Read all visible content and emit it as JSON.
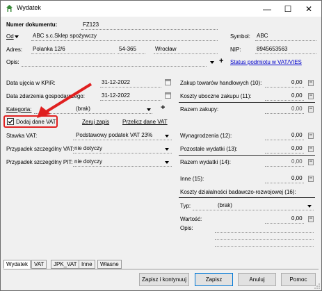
{
  "window": {
    "title": "Wydatek",
    "minimize": "—",
    "maximize": "☐",
    "close": "✕"
  },
  "header": {
    "doc_number_label": "Numer dokumentu:",
    "doc_number_value": "FZ123",
    "od_label": "Od",
    "contractor": "ABC s.c.Sklep spożywczy",
    "symbol_label": "Symbol:",
    "symbol_value": "ABC",
    "address_label": "Adres:",
    "street": "Polanka 12/6",
    "postcode": "54-365",
    "city": "Wrocław",
    "nip_label": "NIP:",
    "nip_value": "8945653563",
    "opis_label": "Opis:",
    "plus": "+",
    "vat_status_link": "Status podmiotu w VAT/VIES"
  },
  "left": {
    "kpir_date_label": "Data ujęcia w KPiR:",
    "kpir_date": "31-12-2022",
    "event_date_label": "Data zdarzenia gospodarczego:",
    "event_date": "31-12-2022",
    "category_label": "Kategoria:",
    "category_value": "(brak)",
    "plus": "+",
    "add_vat_label": "Dodaj dane VAT",
    "reset_link": "Zeruj zapis",
    "recalc_link": "Przelicz dane VAT",
    "vat_rate_label": "Stawka VAT:",
    "vat_rate_value": "Podstawowy podatek VAT 23%",
    "special_vat_label": "Przypadek szczególny VAT:",
    "special_vat_value": "nie dotyczy",
    "special_pit_label": "Przypadek szczególny PIT:",
    "special_pit_value": "nie dotyczy"
  },
  "right": {
    "purchase_label": "Zakup towarów handlowych (10):",
    "purchase_value": "0,00",
    "side_costs_label": "Koszty uboczne zakupu (11):",
    "side_costs_value": "0,00",
    "total_purchase_label": "Razem zakupy:",
    "total_purchase_value": "0,00",
    "salaries_label": "Wynagrodzenia (12):",
    "salaries_value": "0,00",
    "other_label": "Pozostałe wydatki (13):",
    "other_value": "0,00",
    "total_exp_label": "Razem wydatki (14):",
    "total_exp_value": "0,00",
    "inne_label": "Inne (15):",
    "inne_value": "0,00",
    "rd_label": "Koszty działalności badawczo-rozwojowej (16):",
    "typ_label": "Typ:",
    "typ_value": "(brak)",
    "wartosc_label": "Wartość:",
    "wartosc_value": "0,00",
    "opis_label": "Opis:"
  },
  "tabs": [
    "Wydatek",
    "VAT",
    "JPK_VAT",
    "Inne",
    "Własne"
  ],
  "buttons": {
    "save_continue": "Zapisz i kontynuuj",
    "save": "Zapisz",
    "cancel": "Anuluj",
    "help": "Pomoc"
  },
  "colors": {
    "annotation_red": "#e02020",
    "default_button_border": "#0078d7"
  }
}
